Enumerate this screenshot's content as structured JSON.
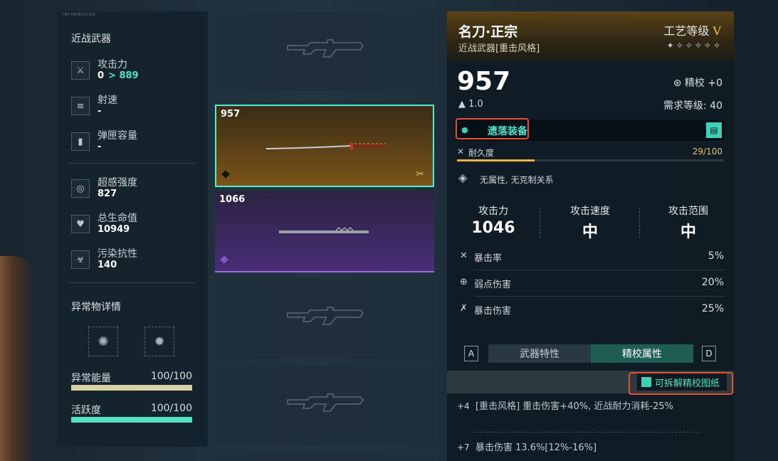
{
  "left": {
    "header_text": "INFORMATION",
    "section_title": "近战武器",
    "stats": [
      {
        "label": "攻击力",
        "value": "0",
        "arrow": "> 889",
        "icon": "attack-icon"
      },
      {
        "label": "射速",
        "value": "-",
        "icon": "fire-rate-icon"
      },
      {
        "label": "弹匣容量",
        "value": "-",
        "icon": "magazine-icon"
      }
    ],
    "stats2": [
      {
        "label": "超感强度",
        "value": "827",
        "icon": "psi-icon"
      },
      {
        "label": "总生命值",
        "value": "10949",
        "icon": "heart-icon"
      },
      {
        "label": "污染抗性",
        "value": "140",
        "icon": "pollution-icon"
      }
    ],
    "anomaly_title": "异常物详情",
    "energy": {
      "label": "异常能量",
      "value": "100/100",
      "fraction": 1.0,
      "color": "#d9d2a8"
    },
    "activity": {
      "label": "活跃度",
      "value": "100/100",
      "fraction": 1.0,
      "color": "#55e0c2"
    }
  },
  "list": {
    "slots": [
      {
        "kind": "empty"
      },
      {
        "kind": "gold",
        "number": "957"
      },
      {
        "kind": "purple",
        "number": "1066"
      },
      {
        "kind": "empty"
      },
      {
        "kind": "empty"
      }
    ]
  },
  "detail": {
    "name": "名刀·正宗",
    "type": "近战武器[重击风格]",
    "craft_label": "工艺等级",
    "craft_level": "V",
    "stars": "✦✧✧✧✧✧",
    "power": "957",
    "ratio": "1.0",
    "refine": "精校 +0",
    "req_level": "需求等级: 40",
    "equip_text": "遗落装备",
    "durability_label": "耐久度",
    "durability_value": "29/100",
    "durability_fraction": 0.29,
    "element": "无属性, 无克制关系",
    "core": [
      {
        "label": "攻击力",
        "value": "1046"
      },
      {
        "label": "攻击速度",
        "value": "中"
      },
      {
        "label": "攻击范围",
        "value": "中"
      }
    ],
    "subs": [
      {
        "label": "暴击率",
        "value": "5%",
        "icon": "crit-rate-icon"
      },
      {
        "label": "弱点伤害",
        "value": "20%",
        "icon": "weakpoint-icon"
      },
      {
        "label": "暴击伤害",
        "value": "25%",
        "icon": "crit-damage-icon"
      }
    ],
    "key_left": "A",
    "key_right": "D",
    "tab_traits": "武器特性",
    "tab_refine": "精校属性",
    "blueprint": "可拆解精校图纸",
    "affixes": [
      {
        "level": "+4",
        "text": "[重击风格] 重击伤害+40%, 近战耐力消耗-25%"
      },
      {
        "level": "+7",
        "text": "暴击伤害 13.6%[12%-16%]"
      }
    ]
  }
}
